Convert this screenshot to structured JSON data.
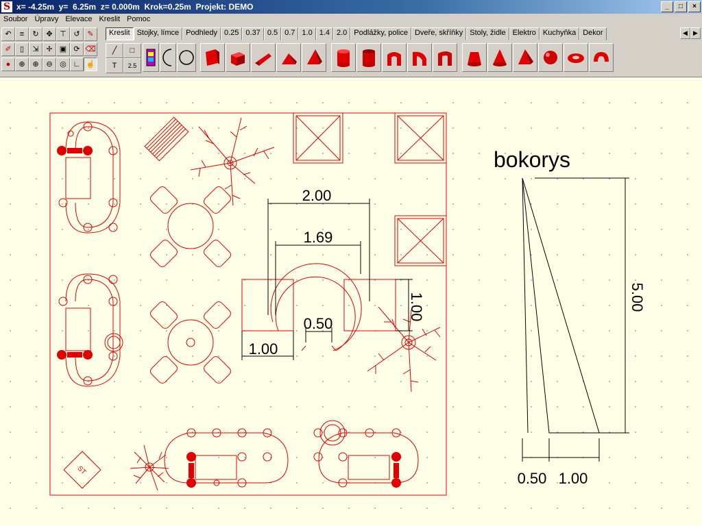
{
  "window": {
    "title": "x= -4.25m  y=  6.25m  z= 0.000m  Krok=0.25m  Projekt: DEMO",
    "app_icon": "S",
    "buttons": {
      "minimize": "_",
      "maximize": "□",
      "close": "×"
    }
  },
  "menu": [
    "Soubor",
    "Úpravy",
    "Elevace",
    "Kreslit",
    "Pomoc"
  ],
  "tool_icons": [
    "undo-icon",
    "text-edit-icon",
    "rotate-icon",
    "move-icon",
    "align-icon",
    "refresh-icon",
    "pen-icon",
    "brush-icon",
    "select-icon",
    "stretch-icon",
    "cross-move-icon",
    "frame-icon",
    "rotate2-icon",
    "erase-icon",
    "palette-icon",
    "zoom-in-icon",
    "zoom-in2-icon",
    "zoom-out-icon",
    "zoom-fit-icon",
    "angle-icon",
    "hand-icon"
  ],
  "tabs": [
    "Kreslit",
    "Stojky, límce",
    "Podhledy",
    "0.25",
    "0.37",
    "0.5",
    "0.7",
    "1.0",
    "1.4",
    "2.0",
    "Podlážky, police",
    "Dveře, skříňky",
    "Stoly, židle",
    "Elektro",
    "Kuchyňka",
    "Dekor"
  ],
  "active_tab": "Kreslit",
  "draw_tools": {
    "text": "T",
    "dim": "2.5"
  },
  "shape_icons": [
    "cube-icon",
    "box-icon",
    "wedge-icon",
    "prism-icon",
    "pyramid-icon",
    "cylinder-icon",
    "cylinder2-icon",
    "arch-icon",
    "arch2-icon",
    "arch3-icon",
    "cone-icon",
    "cone2-icon",
    "pyramid2-icon",
    "sphere-icon",
    "torus-icon",
    "ring-icon"
  ],
  "colors": {
    "draw": "#e00000",
    "canvas": "#ffffe8",
    "dim": "#000000"
  },
  "drawing": {
    "dim_200": "2.00",
    "dim_169": "1.69",
    "dim_050": "0.50",
    "dim_100": "1.00",
    "dim_100v": "1.00",
    "side_title": "bokorys",
    "side_500": "5.00",
    "side_050": "0.50",
    "side_100": "1.00",
    "stamp": "ST"
  }
}
